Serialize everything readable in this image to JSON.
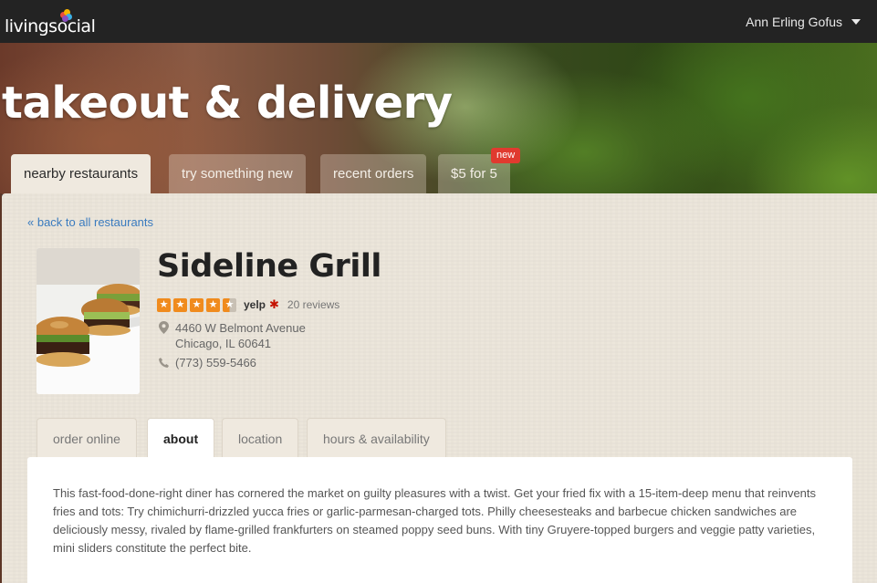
{
  "header": {
    "logo_text": "livingsocial",
    "user_name": "Ann Erling Gofus"
  },
  "hero": {
    "title": "takeout & delivery",
    "tabs": [
      {
        "label": "nearby restaurants",
        "active": true
      },
      {
        "label": "try something new",
        "active": false
      },
      {
        "label": "recent orders",
        "active": false
      },
      {
        "label": "$5 for 5",
        "active": false
      }
    ],
    "badge": "new"
  },
  "restaurant": {
    "back_link": "« back to all restaurants",
    "name": "Sideline Grill",
    "rating": 4.5,
    "rating_source": "yelp",
    "reviews": "20 reviews",
    "address_line1": "4460 W Belmont Avenue",
    "address_line2": "Chicago, IL 60641",
    "phone": "(773) 559-5466"
  },
  "detail_tabs": [
    {
      "label": "order online",
      "active": false
    },
    {
      "label": "about",
      "active": true
    },
    {
      "label": "location",
      "active": false
    },
    {
      "label": "hours & availability",
      "active": false
    }
  ],
  "about": {
    "text": "This fast-food-done-right diner has cornered the market on guilty pleasures with a twist. Get your fried fix with a 15-item-deep menu that reinvents fries and tots: Try chimichurri-drizzled yucca fries or garlic-parmesan-charged tots. Philly cheesesteaks and barbecue chicken sandwiches are deliciously messy, rivaled by flame-grilled frankfurters on steamed poppy seed buns. With tiny Gruyere-topped burgers and veggie patty varieties, mini sliders constitute the perfect bite."
  },
  "colors": {
    "accent_link": "#3a7bbf",
    "star": "#f08b1d",
    "badge": "#e03a2f"
  },
  "icons": [
    "logo-dots-icon",
    "chevron-down-icon",
    "star-icon",
    "yelp-burst-icon",
    "map-pin-icon",
    "phone-icon"
  ]
}
